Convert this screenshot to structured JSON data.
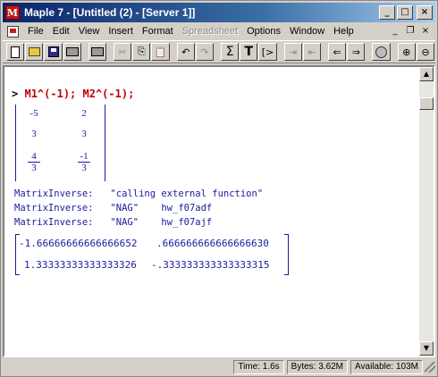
{
  "window": {
    "title": "Maple 7 - [Untitled (2) - [Server 1]]",
    "app_icon_glyph": "M",
    "controls": {
      "minimize": "_",
      "maximize": "□",
      "close": "×"
    }
  },
  "menubar": {
    "items": [
      {
        "label": "File",
        "enabled": true
      },
      {
        "label": "Edit",
        "enabled": true
      },
      {
        "label": "View",
        "enabled": true
      },
      {
        "label": "Insert",
        "enabled": true
      },
      {
        "label": "Format",
        "enabled": true
      },
      {
        "label": "Spreadsheet",
        "enabled": false
      },
      {
        "label": "Options",
        "enabled": true
      },
      {
        "label": "Window",
        "enabled": true
      },
      {
        "label": "Help",
        "enabled": true
      }
    ],
    "mdi_controls": {
      "minimize": "_",
      "restore": "❐",
      "close": "×"
    }
  },
  "toolbar": {
    "buttons": [
      {
        "name": "new-icon"
      },
      {
        "name": "open-icon"
      },
      {
        "name": "save-icon"
      },
      {
        "name": "print-icon"
      },
      {
        "name": "cut-icon",
        "glyph": "✂"
      },
      {
        "name": "copy-icon",
        "glyph": "⎘"
      },
      {
        "name": "paste-icon",
        "glyph": "📋"
      },
      {
        "name": "undo-icon",
        "glyph": "↶"
      },
      {
        "name": "redo-icon",
        "glyph": "↷"
      },
      {
        "name": "sigma-icon",
        "glyph": "Σ"
      },
      {
        "name": "text-icon",
        "glyph": "T"
      },
      {
        "name": "prompt-icon",
        "glyph": "[>"
      },
      {
        "name": "indent-icon",
        "glyph": "⇥"
      },
      {
        "name": "outdent-icon",
        "glyph": "⇤"
      },
      {
        "name": "back-icon",
        "glyph": "⇐"
      },
      {
        "name": "forward-icon",
        "glyph": "⇒"
      },
      {
        "name": "stop-icon"
      },
      {
        "name": "zoom-in-icon",
        "glyph": "🔍"
      },
      {
        "name": "zoom-out-icon",
        "glyph": "🔎"
      }
    ]
  },
  "worksheet": {
    "prompt": ">",
    "command": "M1^(-1); M2^(-1);",
    "matrix1": {
      "r1": [
        "-5",
        "2"
      ],
      "r2": [
        "3",
        "3"
      ],
      "r3": [
        {
          "num": "4",
          "den": "3"
        },
        {
          "num": "-1",
          "den": "3"
        }
      ]
    },
    "info_lines": [
      "MatrixInverse:   \"calling external function\"",
      "MatrixInverse:   \"NAG\"    hw_f07adf",
      "MatrixInverse:   \"NAG\"    hw_f07ajf"
    ],
    "matrix2": {
      "r1": [
        "-1.66666666666666652",
        ".666666666666666630"
      ],
      "r2": [
        "1.33333333333333326",
        "-.333333333333333315"
      ]
    }
  },
  "statusbar": {
    "time": "Time: 1.6s",
    "bytes": "Bytes: 3.62M",
    "available": "Available: 103M"
  },
  "colors": {
    "title_gradient_start": "#0a246a",
    "input_red": "#c00000",
    "output_blue": "#1a1aa0",
    "chrome": "#d4d0c8"
  }
}
